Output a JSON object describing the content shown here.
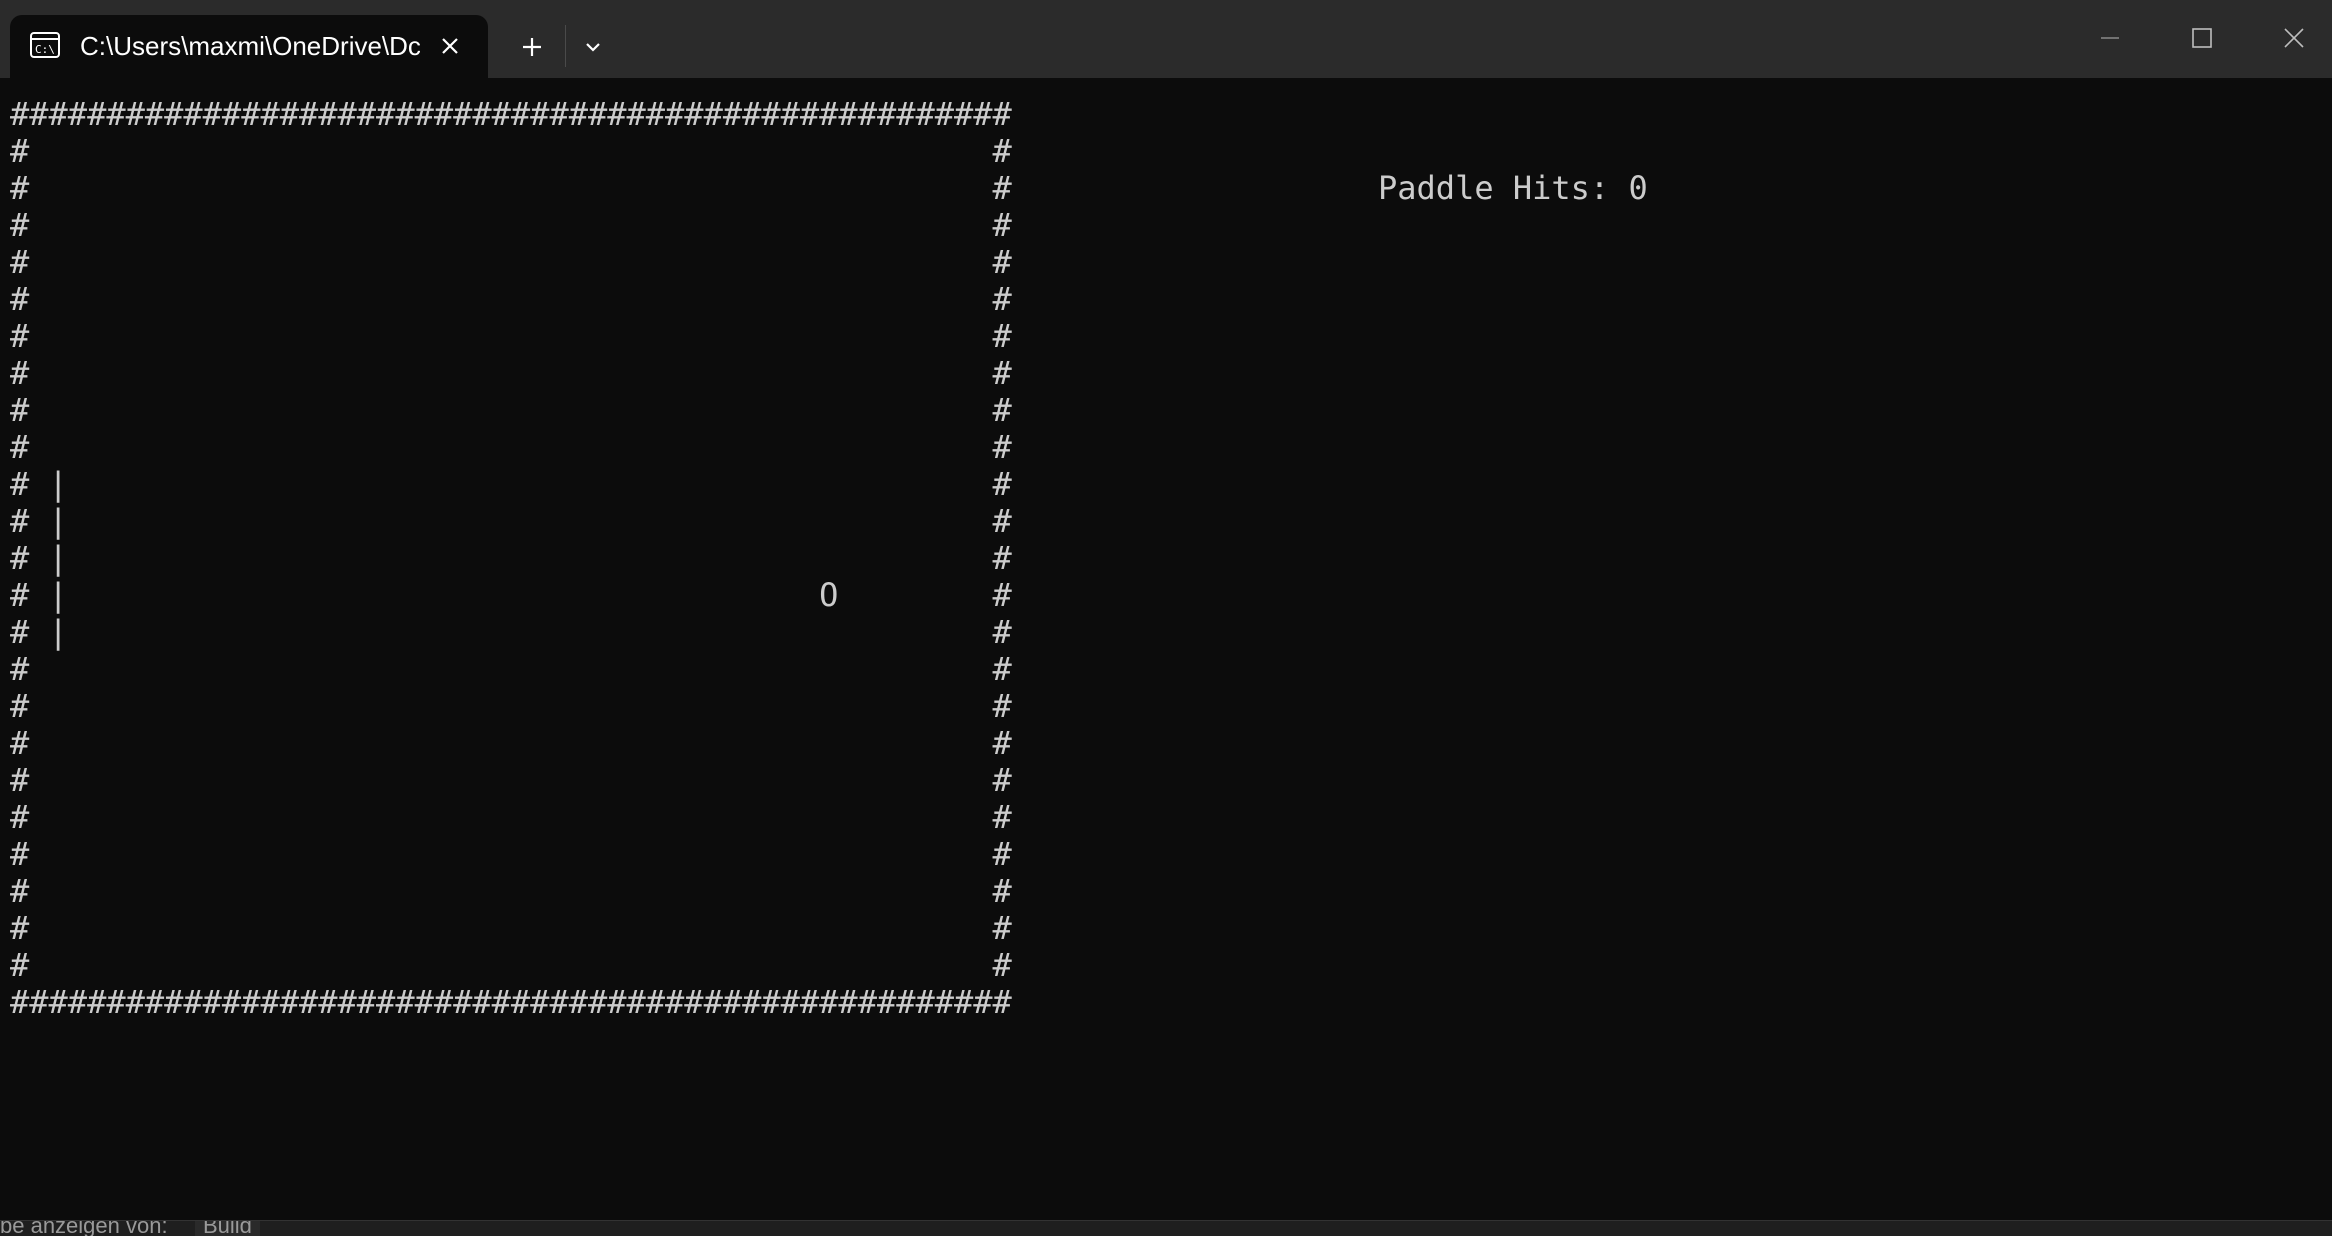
{
  "window": {
    "tab_title": "C:\\Users\\maxmi\\OneDrive\\Dc",
    "tab_icon": "console-icon"
  },
  "game": {
    "field": "####################################################\n#                                                  #\n#                                                  #\n#                                                  #\n#                                                  #\n#                                                  #\n#                                                  #\n#                                                  #\n#                                                  #\n#                                                  #\n# |                                                #\n# |                                                #\n# |                                                #\n# |                                       O        #\n# |                                                #\n#                                                  #\n#                                                  #\n#                                                  #\n#                                                  #\n#                                                  #\n#                                                  #\n#                                                  #\n#                                                  #\n#                                                  #\n####################################################",
    "hud": "Paddle Hits: 0"
  },
  "background_strip": {
    "text": "be anzeigen von:",
    "field_value": "Build"
  },
  "colors": {
    "titlebar": "#2b2b2b",
    "console_bg": "#0c0c0c",
    "console_fg": "#cccccc"
  }
}
